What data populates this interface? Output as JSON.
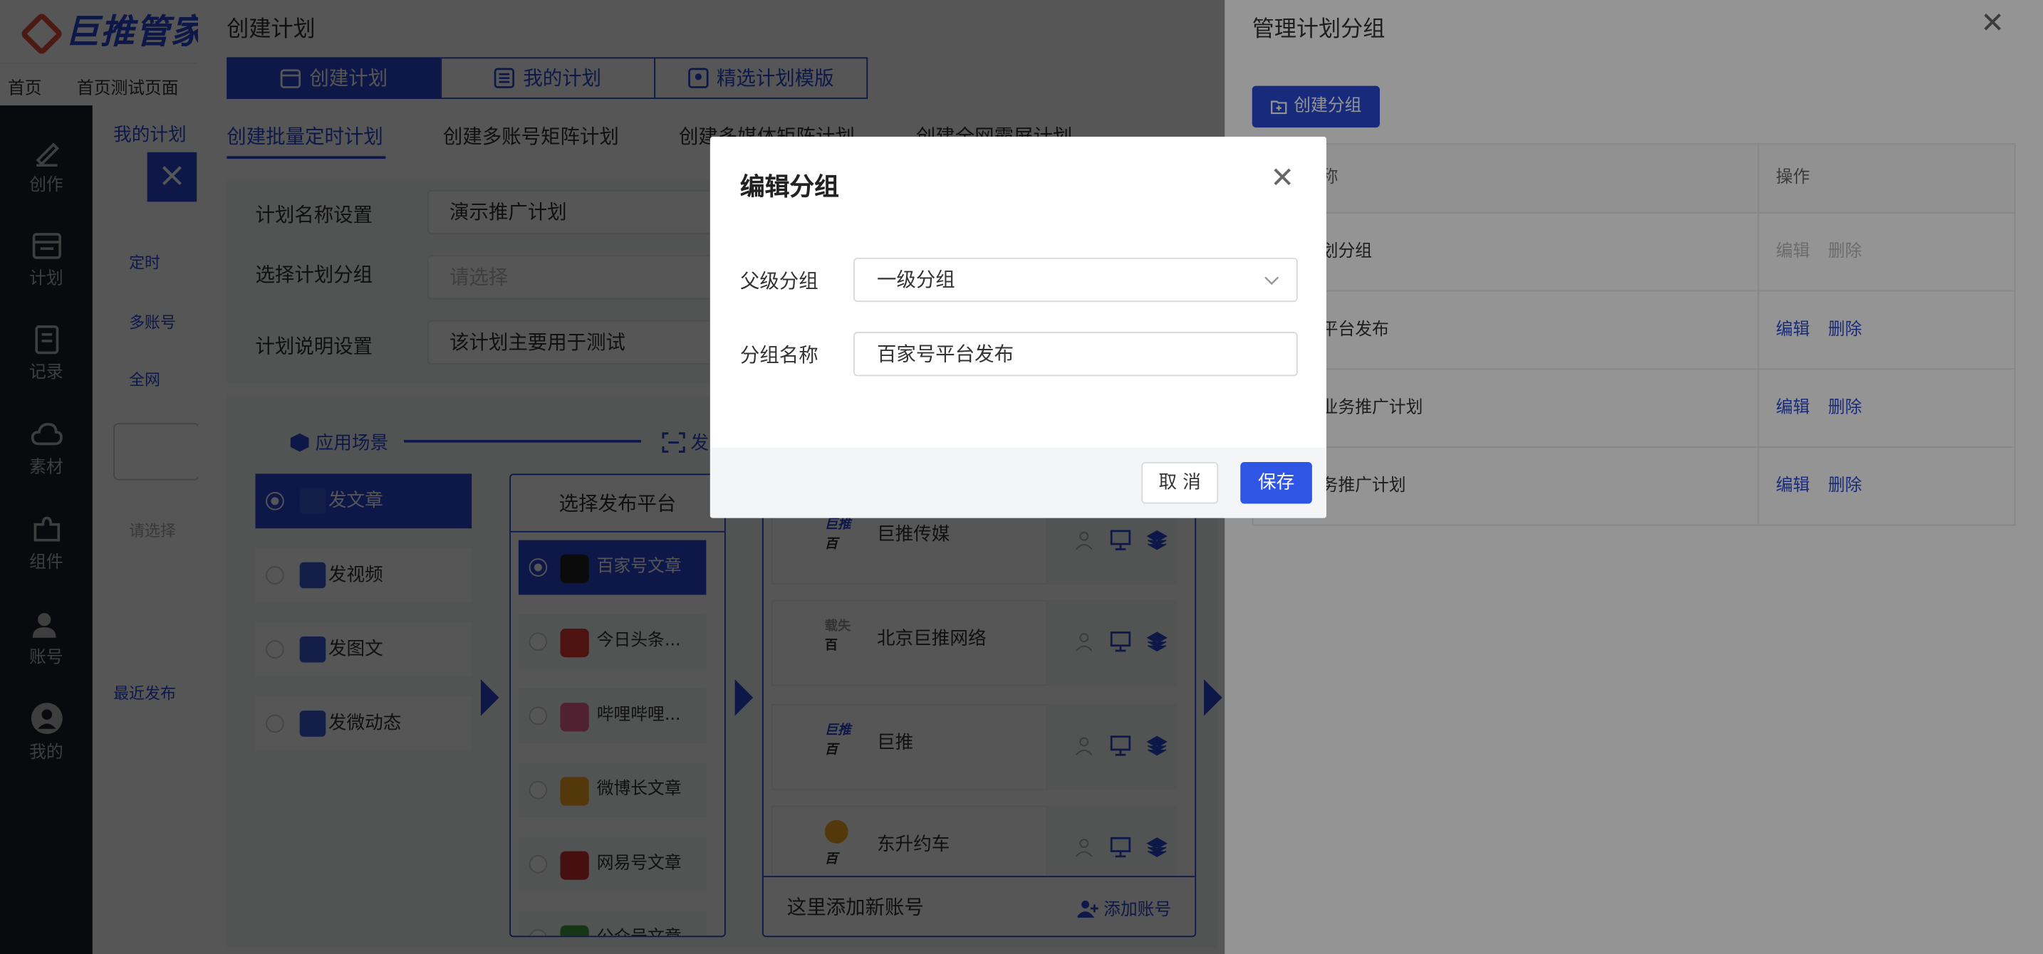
{
  "app": {
    "logo_text": "巨推管家"
  },
  "top_tabs": [
    "首页",
    "首页测试页面"
  ],
  "sidebar": {
    "items": [
      {
        "label": "创作",
        "icon": "pen-icon"
      },
      {
        "label": "计划",
        "icon": "calendar-icon"
      },
      {
        "label": "记录",
        "icon": "record-icon"
      },
      {
        "label": "素材",
        "icon": "cloud-icon"
      },
      {
        "label": "组件",
        "icon": "puzzle-icon"
      },
      {
        "label": "账号",
        "icon": "account-icon"
      },
      {
        "label": "我的",
        "icon": "user-icon"
      }
    ]
  },
  "left_panel": {
    "title": "我的计划",
    "item_timing": "定时",
    "item_multi": "多账号",
    "item_all": "全网",
    "search_placeholder": "请选择",
    "recent_link": "最近发布"
  },
  "create_plan": {
    "title": "创建计划",
    "segments": [
      "创建计划",
      "我的计划",
      "精选计划模版"
    ],
    "subtabs": [
      "创建批量定时计划",
      "创建多账号矩阵计划",
      "创建多媒体矩阵计划",
      "创建全网霸屏计划"
    ],
    "form": {
      "name_label": "计划名称设置",
      "name_value": "演示推广计划",
      "group_label": "选择计划分组",
      "group_placeholder": "请选择",
      "desc_label": "计划说明设置",
      "desc_value": "该计划主要用于测试"
    },
    "steps": {
      "scene": "应用场景",
      "publish": "发"
    },
    "scenes": [
      "发文章",
      "发视频",
      "发图文",
      "发微动态"
    ],
    "platform_header": "选择发布平台",
    "platforms": [
      {
        "label": "百家号文章",
        "color": "#2a49d6"
      },
      {
        "label": "今日头条...",
        "color": "#e53935"
      },
      {
        "label": "哔哩哔哩...",
        "color": "#f06292"
      },
      {
        "label": "微博长文章",
        "color": "#f9a825"
      },
      {
        "label": "网易号文章",
        "color": "#d32f2f"
      },
      {
        "label": "公众号文章",
        "color": "#43a047"
      }
    ],
    "accounts": [
      "巨推传媒",
      "北京巨推网络",
      "巨推",
      "东升约车"
    ],
    "account_logo_text": "巨推",
    "account_badge": "百",
    "account_fail_text": "载失",
    "add_account_text": "这里添加新账号",
    "add_account_link": "添加账号"
  },
  "manage_groups": {
    "title": "管理计划分组",
    "create_button": "创建分组",
    "columns": [
      "称",
      "操作"
    ],
    "rows": [
      {
        "name": "划分组",
        "edit": "编辑",
        "delete": "删除",
        "disabled": true
      },
      {
        "name": "平台发布",
        "edit": "编辑",
        "delete": "删除",
        "disabled": false
      },
      {
        "name": "业务推广计划",
        "edit": "编辑",
        "delete": "删除",
        "disabled": false
      },
      {
        "name": "务推广计划",
        "edit": "编辑",
        "delete": "删除",
        "disabled": false
      }
    ]
  },
  "edit_modal": {
    "title": "编辑分组",
    "parent_label": "父级分组",
    "parent_value": "一级分组",
    "name_label": "分组名称",
    "name_value": "百家号平台发布",
    "cancel_label": "取 消",
    "save_label": "保存"
  },
  "colors": {
    "primary": "#2a49d6",
    "save_button": "#2f55e4",
    "sidebar": "#1c1f2a"
  }
}
